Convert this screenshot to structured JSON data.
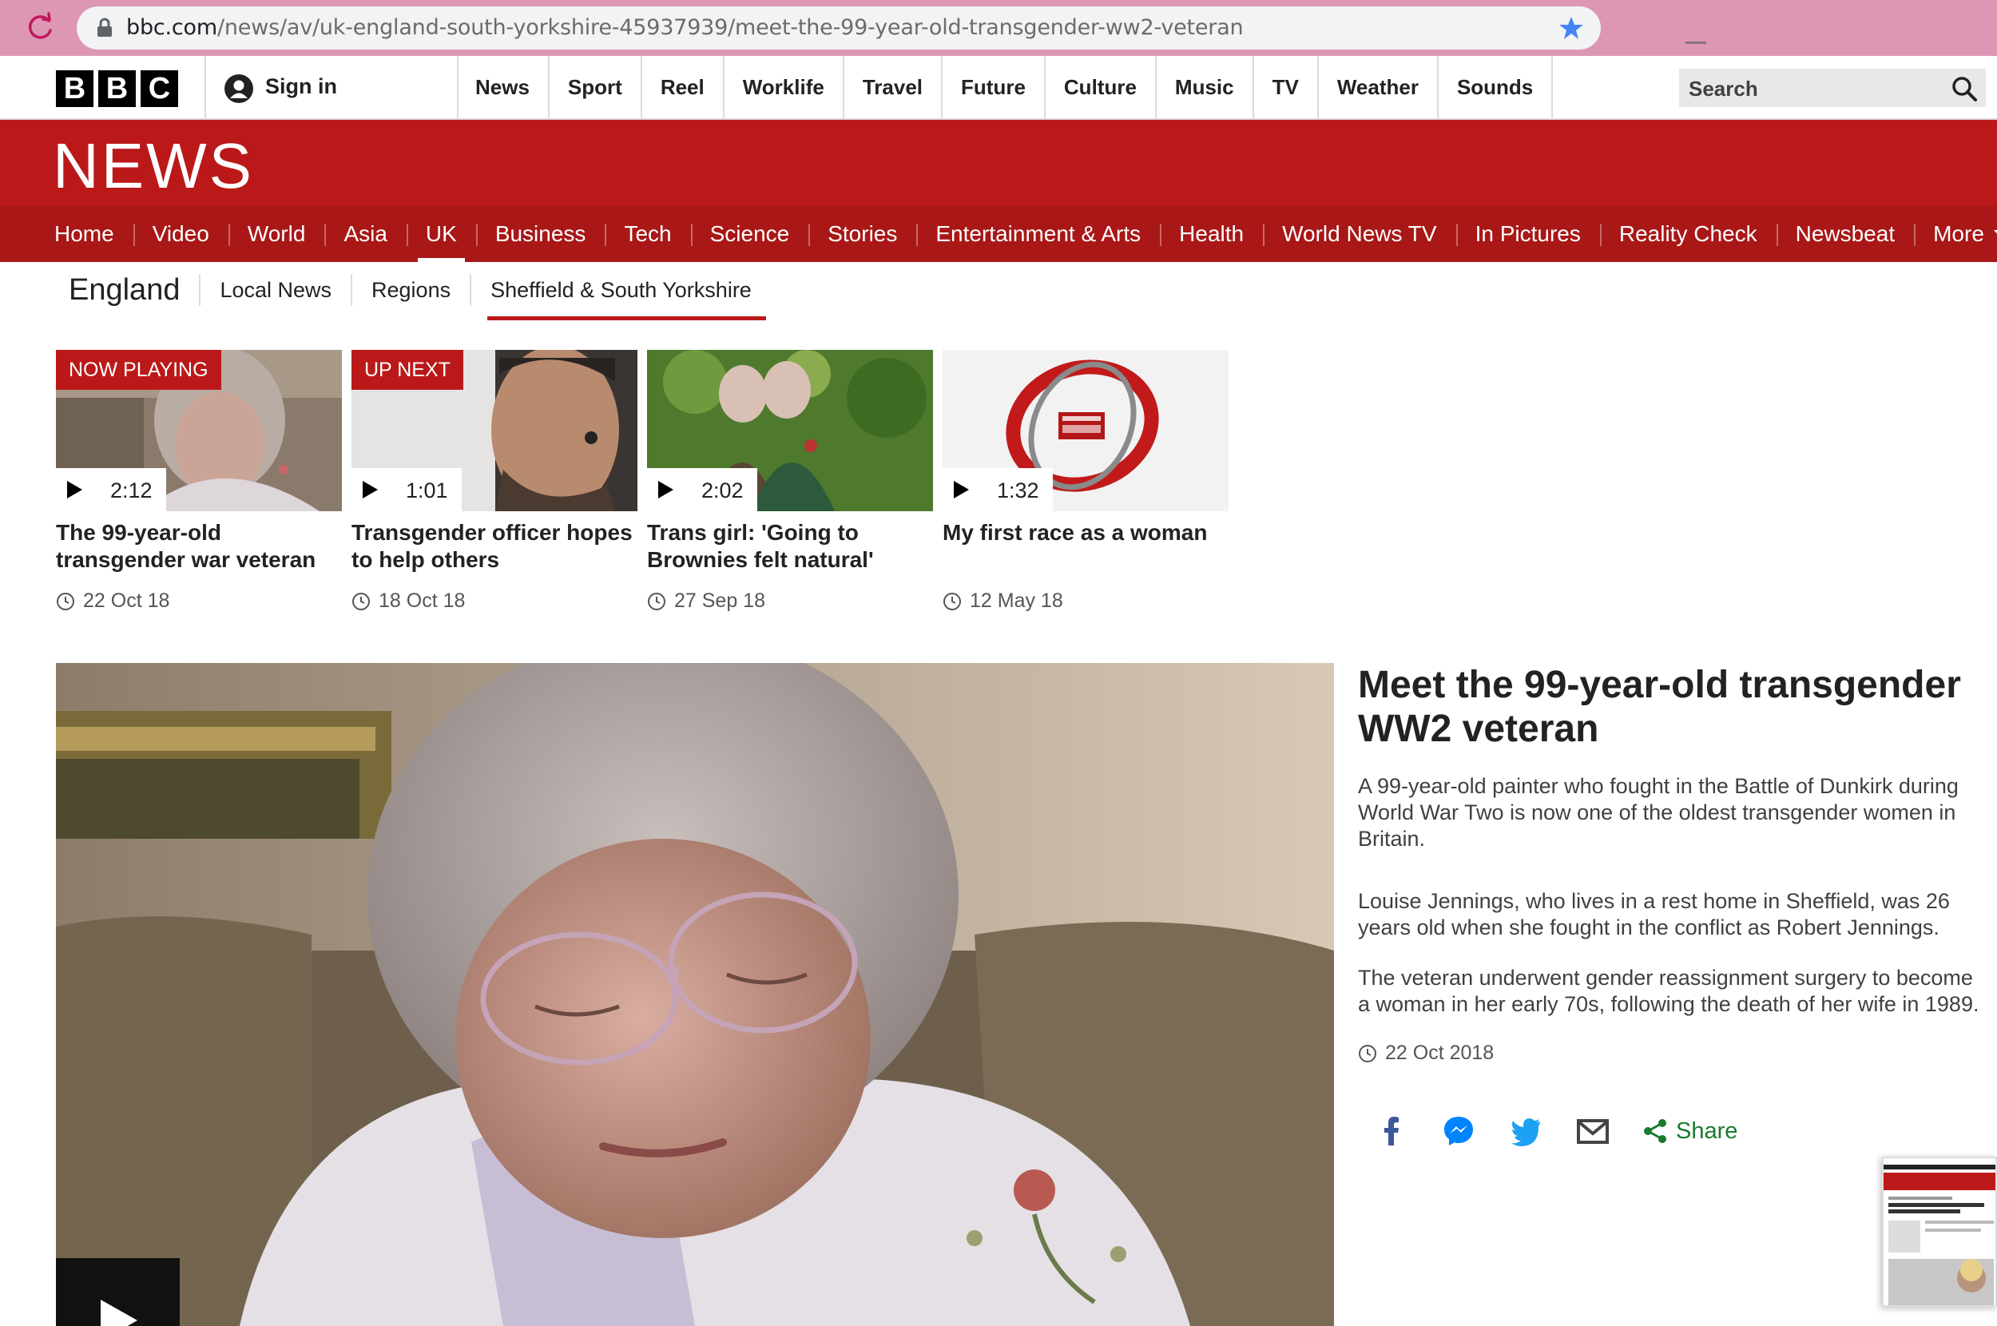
{
  "browser": {
    "url_domain": "bbc.com",
    "url_path": "/news/av/uk-england-south-yorkshire-45937939/meet-the-99-year-old-transgender-ww2-veteran"
  },
  "bbc_bar": {
    "logo_letters": [
      "B",
      "B",
      "C"
    ],
    "sign_in_label": "Sign in",
    "nav": [
      "News",
      "Sport",
      "Reel",
      "Worklife",
      "Travel",
      "Future",
      "Culture",
      "Music",
      "TV",
      "Weather",
      "Sounds"
    ],
    "search_label": "Search"
  },
  "news_band": {
    "wordmark": "NEWS"
  },
  "section_nav": {
    "items": [
      "Home",
      "Video",
      "World",
      "Asia",
      "UK",
      "Business",
      "Tech",
      "Science",
      "Stories",
      "Entertainment & Arts",
      "Health",
      "World News TV",
      "In Pictures",
      "Reality Check",
      "Newsbeat",
      "More"
    ],
    "active": "UK"
  },
  "sub_nav": {
    "title": "England",
    "items": [
      "Local News",
      "Regions",
      "Sheffield & South Yorkshire"
    ],
    "active": "Sheffield & South Yorkshire"
  },
  "videos": [
    {
      "badge": "NOW PLAYING",
      "duration": "2:12",
      "headline": "The 99-year-old transgender war veteran",
      "date": "22 Oct 18"
    },
    {
      "badge": "UP NEXT",
      "duration": "1:01",
      "headline": "Transgender officer hopes to help others",
      "date": "18 Oct 18"
    },
    {
      "badge": "",
      "duration": "2:02",
      "headline": "Trans girl: 'Going to Brownies felt natural'",
      "date": "27 Sep 18"
    },
    {
      "badge": "",
      "duration": "1:32",
      "headline": "My first race as a woman",
      "date": "12 May 18"
    }
  ],
  "article": {
    "title": "Meet the 99-year-old transgender WW2 veteran",
    "paragraphs": [
      "A 99-year-old painter who fought in the Battle of Dunkirk during World War Two is now one of the oldest transgender women in Britain.",
      "Louise Jennings, who lives in a rest home in Sheffield, was 26 years old when she fought in the conflict as Robert Jennings.",
      "The veteran underwent gender reassignment surgery to become a woman in her early 70s, following the death of her wife in 1989."
    ],
    "date": "22 Oct 2018",
    "share_label": "Share"
  },
  "colors": {
    "bbc_red": "#bb1919",
    "bbc_red_dark": "#a91717",
    "share_green": "#1a7a2e",
    "facebook": "#3b5998",
    "messenger": "#0084ff",
    "twitter": "#1da1f2"
  },
  "icons": [
    "reload-icon",
    "lock-icon",
    "bookmark-star-icon",
    "user-icon",
    "search-icon",
    "play-icon",
    "clock-icon",
    "facebook-icon",
    "messenger-icon",
    "twitter-icon",
    "email-icon",
    "share-icon"
  ]
}
